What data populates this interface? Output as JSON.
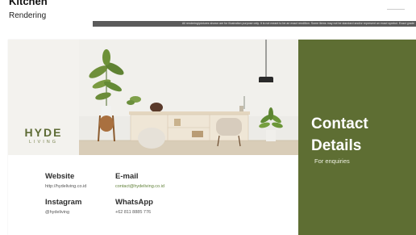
{
  "previous_page": {
    "title": "Kitchen",
    "subtitle": "Rendering",
    "disclaimer": "All rendering/pictures shown are for illustration purpose only. It is not meant to be an exact rendition. Some items may not be standard and/or represent an exact symbol. Exact grade"
  },
  "brand": {
    "name": "HYDE",
    "tagline": "LIVING"
  },
  "contact_panel": {
    "title": "Contact Details",
    "subtitle": "For enquiries"
  },
  "contacts": {
    "website": {
      "label": "Website",
      "value": "http://hydeliving.co.id"
    },
    "email": {
      "label": "E-mail",
      "value": "contact@hydeliving.co.id"
    },
    "instagram": {
      "label": "Instagram",
      "value": "@hydeliving"
    },
    "whatsapp": {
      "label": "WhatsApp",
      "value": "+62 811 8885 776"
    }
  },
  "colors": {
    "brand_green": "#5e6e33",
    "link_green": "#5e7f35",
    "logo_bg": "#f3f2ee"
  }
}
